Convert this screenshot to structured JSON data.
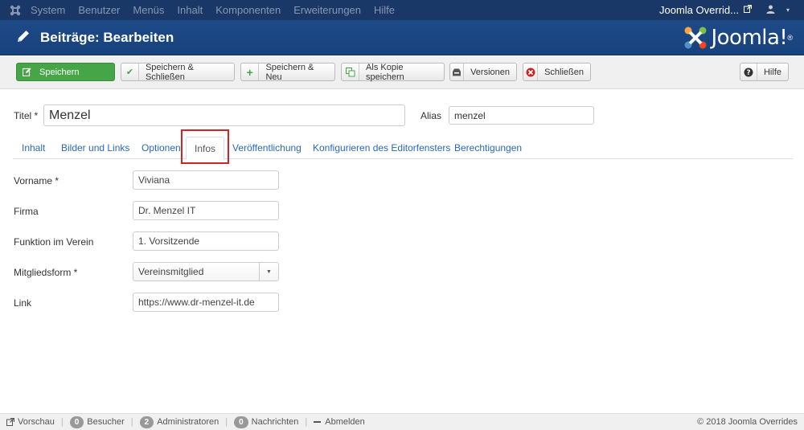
{
  "topnav": {
    "menu": [
      "System",
      "Benutzer",
      "Menüs",
      "Inhalt",
      "Komponenten",
      "Erweiterungen",
      "Hilfe"
    ],
    "site_name": "Joomla Overrid...",
    "icons": {
      "logo": "joomla-icon",
      "external": "external-link-icon",
      "user": "user-icon"
    }
  },
  "header": {
    "title": "Beiträge: Bearbeiten",
    "brand": "Joomla!",
    "brand_mark": "®"
  },
  "toolbar": {
    "save": "Speichern",
    "save_close": "Speichern & Schließen",
    "save_new": "Speichern & Neu",
    "save_copy": "Als Kopie speichern",
    "versions": "Versionen",
    "close": "Schließen",
    "help": "Hilfe"
  },
  "form": {
    "title_label": "Titel *",
    "title_value": "Menzel",
    "alias_label": "Alias",
    "alias_value": "menzel"
  },
  "tabs": [
    "Inhalt",
    "Bilder und Links",
    "Optionen",
    "Infos",
    "Veröffentlichung",
    "Konfigurieren des Editorfensters",
    "Berechtigungen"
  ],
  "active_tab": "Infos",
  "fields": {
    "vorname_label": "Vorname *",
    "vorname_value": "Viviana",
    "firma_label": "Firma",
    "firma_value": "Dr. Menzel IT",
    "funktion_label": "Funktion im Verein",
    "funktion_value": "1. Vorsitzende",
    "mitglied_label": "Mitgliedsform *",
    "mitglied_value": "Vereinsmitglied",
    "link_label": "Link",
    "link_value": "https://www.dr-menzel-it.de"
  },
  "statusbar": {
    "preview": "Vorschau",
    "visitors_count": "0",
    "visitors": "Besucher",
    "admins_count": "2",
    "admins": "Administratoren",
    "messages_count": "0",
    "messages": "Nachrichten",
    "logout": "Abmelden",
    "copyright": "© 2018 Joomla Overrides"
  },
  "colors": {
    "nav": "#1a3867",
    "header": "#1e4a88",
    "save": "#46a546",
    "link": "#2a69b8",
    "highlight": "#d32424"
  }
}
